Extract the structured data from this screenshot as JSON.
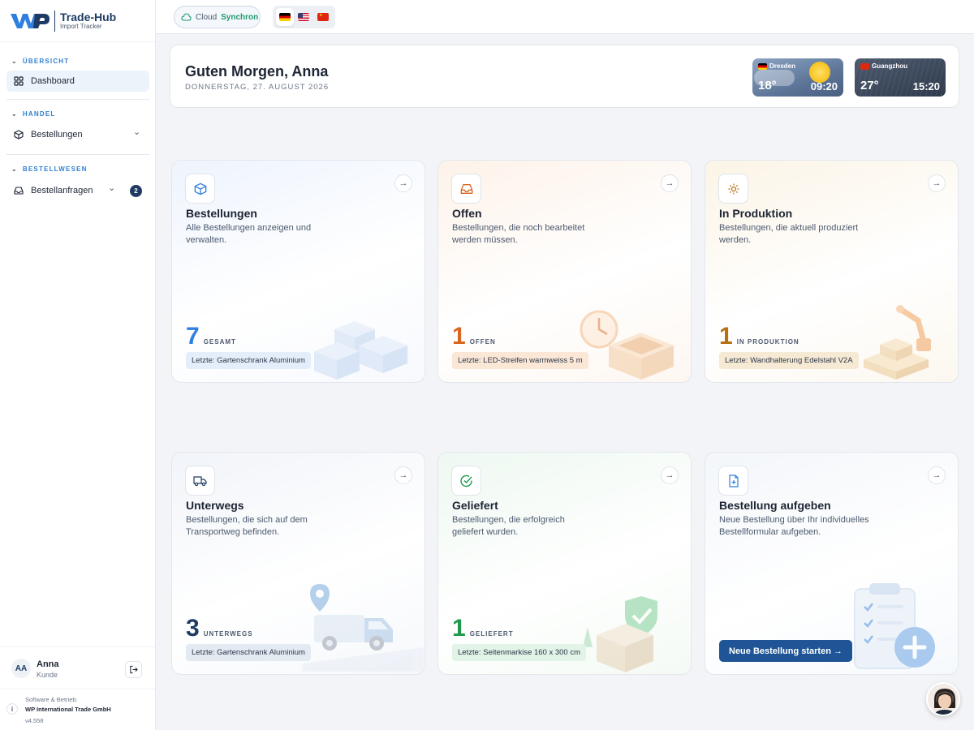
{
  "brand": {
    "name": "Trade-Hub",
    "subtitle": "Import Tracker"
  },
  "sidebar": {
    "sections": [
      {
        "title": "ÜBERSICHT",
        "items": [
          {
            "label": "Dashboard",
            "icon": "grid-icon",
            "active": true
          }
        ]
      },
      {
        "title": "HANDEL",
        "items": [
          {
            "label": "Bestellungen",
            "icon": "box-icon"
          }
        ]
      },
      {
        "title": "BESTELLWESEN",
        "items": [
          {
            "label": "Bestellanfragen",
            "icon": "inbox-icon",
            "badge": "2"
          }
        ]
      }
    ],
    "user": {
      "initials": "AA",
      "name": "Anna",
      "role": "Kunde"
    },
    "footer": {
      "label": "Software & Betrieb:",
      "company": "WP International Trade GmbH",
      "version": "v4.558"
    }
  },
  "topbar": {
    "cloud_label": "Cloud",
    "cloud_status": "Synchron",
    "languages": [
      "de",
      "us",
      "cn"
    ]
  },
  "greeting": {
    "title": "Guten Morgen, Anna",
    "date": "DONNERSTAG, 27. AUGUST 2026",
    "weather": [
      {
        "city": "Dresden",
        "temp": "18°",
        "time": "09:20",
        "flag": "de"
      },
      {
        "city": "Guangzhou",
        "temp": "27°",
        "time": "15:20",
        "flag": "cn"
      }
    ]
  },
  "cards": [
    {
      "title": "Bestellungen",
      "desc": "Alle Bestellungen anzeigen und verwalten.",
      "count": "7",
      "count_label": "GESAMT",
      "last": "Letzte: Gartenschrank Aluminium",
      "color": "#2f7fe0"
    },
    {
      "title": "Offen",
      "desc": "Bestellungen, die noch bearbeitet werden müssen.",
      "count": "1",
      "count_label": "OFFEN",
      "last": "Letzte: LED-Streifen warmweiss 5 m",
      "color": "#d9661f"
    },
    {
      "title": "In Produktion",
      "desc": "Bestellungen, die aktuell produziert werden.",
      "count": "1",
      "count_label": "IN PRODUKTION",
      "last": "Letzte: Wandhalterung Edelstahl V2A",
      "color": "#b7700f"
    },
    {
      "title": "Unterwegs",
      "desc": "Bestellungen, die sich auf dem Transportweg befinden.",
      "count": "3",
      "count_label": "UNTERWEGS",
      "last": "Letzte: Gartenschrank Aluminium",
      "color": "#1f3b64"
    },
    {
      "title": "Geliefert",
      "desc": "Bestellungen, die erfolgreich geliefert wurden.",
      "count": "1",
      "count_label": "GELIEFERT",
      "last": "Letzte: Seitenmarkise 160 x 300 cm",
      "color": "#1f9a4d"
    },
    {
      "title": "Bestellung aufgeben",
      "desc": "Neue Bestellung über Ihr individuelles Bestellformular aufgeben.",
      "button": "Neue Bestellung starten →"
    }
  ]
}
